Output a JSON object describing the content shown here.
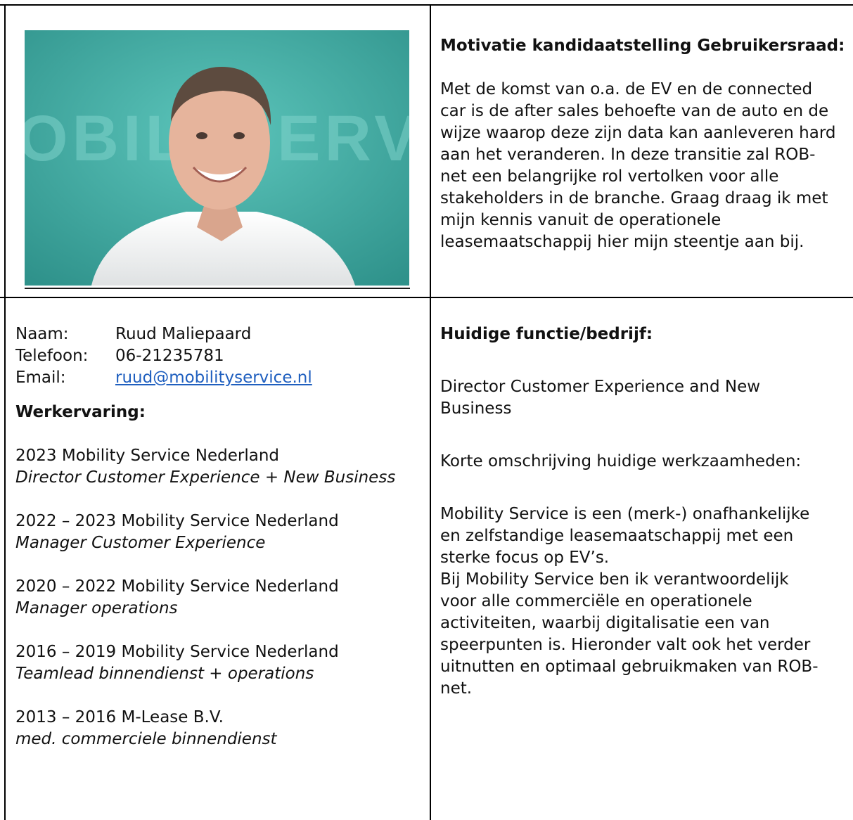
{
  "photo": {
    "alt": "Portrait photo",
    "wall_text": "OBILIT  ERV",
    "colors": {
      "wall": "#4fb7ad",
      "wall_dark": "#2f8f8a",
      "shirt": "#f4f4f2",
      "skin": "#e3b19a",
      "hair": "#5a4a40"
    }
  },
  "motivation": {
    "title": "Motivatie kandidaatstelling Gebruikersraad:",
    "lines": [
      "Met de komst van o.a. de EV en de connected",
      "car is de after sales behoefte van de auto en de",
      "wijze waarop deze zijn data kan aanleveren hard",
      "aan het veranderen. In deze transitie zal ROB-",
      "net een belangrijke rol vertolken voor alle",
      "stakeholders in de branche. Graag draag ik met",
      "mijn kennis vanuit de operationele",
      "leasemaatschappij hier mijn steentje aan bij."
    ]
  },
  "contact": {
    "name_label": "Naam:",
    "name_value": "Ruud Maliepaard",
    "phone_label": "Telefoon:",
    "phone_value": "06-21235781",
    "email_label": "Email:",
    "email_value": "ruud@mobilityservice.nl"
  },
  "experience": {
    "title": "Werkervaring:",
    "entries": [
      {
        "period": "2023 Mobility Service Nederland",
        "role": "Director Customer Experience + New Business"
      },
      {
        "period": "2022 – 2023 Mobility Service Nederland",
        "role": "Manager Customer Experience"
      },
      {
        "period": "2020 – 2022 Mobility Service Nederland",
        "role": "Manager operations"
      },
      {
        "period": "2016 – 2019 Mobility Service Nederland",
        "role": "Teamlead binnendienst  + operations"
      },
      {
        "period": "2013 – 2016 M-Lease B.V.",
        "role": "med. commerciele binnendienst"
      }
    ]
  },
  "current": {
    "title": "Huidige functie/bedrijf:",
    "role_lines": [
      "Director Customer Experience and New",
      "Business"
    ],
    "desc_title": "Korte omschrijving huidige werkzaamheden:",
    "desc_lines": [
      "Mobility Service is een (merk-) onafhankelijke",
      "en zelfstandige leasemaatschappij met een",
      "sterke focus op EV’s.",
      "Bij Mobility Service ben ik verantwoordelijk",
      "voor alle commerciële en operationele",
      "activiteiten, waarbij digitalisatie een van",
      "speerpunten is. Hieronder valt ook het verder",
      "uitnutten en optimaal gebruikmaken van ROB-",
      "net."
    ]
  }
}
